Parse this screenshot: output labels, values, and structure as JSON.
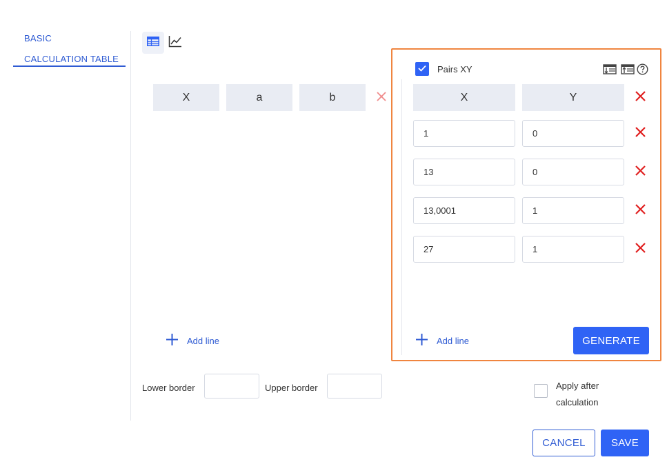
{
  "nav": {
    "items": [
      {
        "label": "BASIC",
        "active": false
      },
      {
        "label": "CALCULATION TABLE",
        "active": true
      }
    ]
  },
  "view_toggle": {
    "table_icon": "table-icon",
    "chart_icon": "line-chart-icon"
  },
  "left_table": {
    "columns": [
      "X",
      "a",
      "b"
    ],
    "add_line_label": "Add line"
  },
  "pairs_panel": {
    "checkbox_label": "Pairs XY",
    "checkbox_checked": true,
    "icons": [
      "sort-descending-icon",
      "sort-ascending-icon",
      "help-icon"
    ],
    "columns": [
      "X",
      "Y"
    ],
    "rows": [
      {
        "x": "1",
        "y": "0"
      },
      {
        "x": "13",
        "y": "0"
      },
      {
        "x": "13,0001",
        "y": "1"
      },
      {
        "x": "27",
        "y": "1"
      }
    ],
    "add_line_label": "Add line",
    "generate_label": "GENERATE"
  },
  "borders": {
    "lower_label": "Lower border",
    "upper_label": "Upper border",
    "lower_value": "",
    "upper_value": ""
  },
  "apply_after": {
    "label_line1": "Apply after",
    "label_line2": "calculation",
    "checked": false
  },
  "footer": {
    "cancel_label": "CANCEL",
    "save_label": "SAVE"
  },
  "colors": {
    "accent": "#2f63f5",
    "delete_red": "#e02020",
    "highlight_orange": "#f0853f",
    "header_gray": "#e9ecf3"
  }
}
